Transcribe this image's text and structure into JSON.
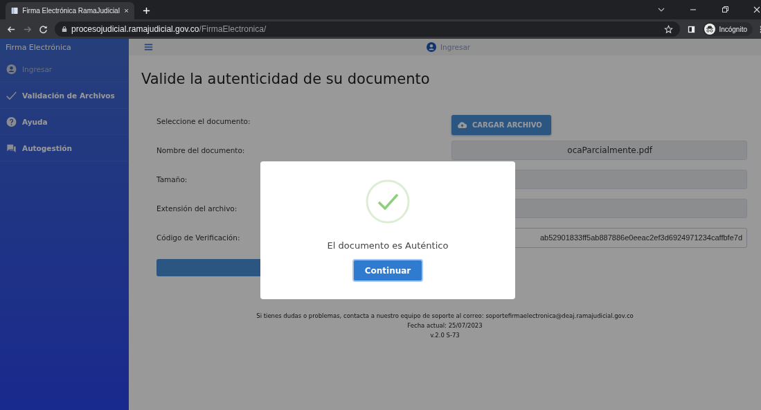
{
  "browser": {
    "tab_title": "Firma Electrónica RamaJudicial",
    "url_host": "procesojudicial.ramajudicial.gov.co",
    "url_path": "/FirmaElectronica/",
    "profile_label": "Incógnito"
  },
  "sidebar": {
    "title": "Firma Electrónica",
    "items": [
      {
        "label": "Ingresar",
        "disabled": true
      },
      {
        "label": "Validación de Archivos",
        "disabled": false
      },
      {
        "label": "Ayuda",
        "disabled": false
      },
      {
        "label": "Autogestión",
        "disabled": false
      }
    ]
  },
  "topbar": {
    "login_label": "Ingresar"
  },
  "page": {
    "heading": "Valide la autenticidad de su documento",
    "fields": [
      {
        "label": "Seleccione el documento:",
        "kind": "upload",
        "button": "CARGAR ARCHIVO"
      },
      {
        "label": "Nombre del documento:",
        "kind": "readonly",
        "value": "ocaParcialmente.pdf"
      },
      {
        "label": "Tamaño:",
        "kind": "readonly"
      },
      {
        "label": "Extensión del archivo:",
        "kind": "readonly"
      },
      {
        "label": "Código de Verificación:",
        "kind": "input",
        "value": "ab52901833ff5ab887886e0eeac2ef3d6924971234caffbfe7d"
      }
    ]
  },
  "footer": [
    "Si tienes dudas o problemas, contacta a nuestro equipo de soporte al correo: soportefirmaelectronica@deaj.ramajudicial.gov.co",
    "Fecha actual: 25/07/2023",
    "v.2.0 S-73"
  ],
  "dialog": {
    "message": "El documento es Auténtico",
    "button": "Continuar"
  }
}
